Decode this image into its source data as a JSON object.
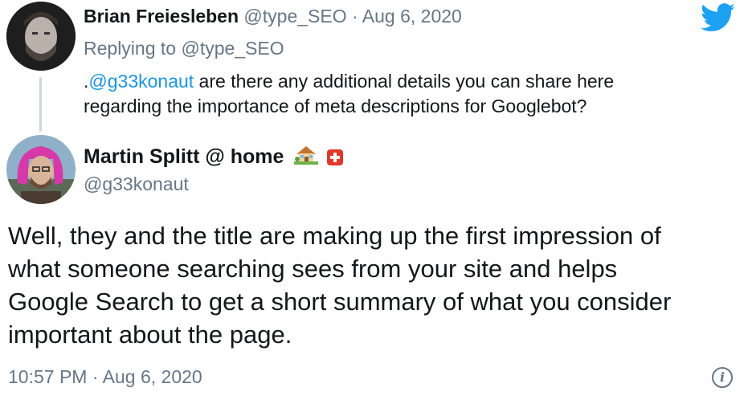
{
  "reply_tweet": {
    "author_name": "Brian Freiesleben",
    "author_handle": "@type_SEO",
    "separator": "·",
    "date": "Aug 6, 2020",
    "replying_to_prefix": "Replying to",
    "replying_to_handle": "@type_SEO",
    "text_prefix": ".",
    "mention": "@g33konaut",
    "text_line1_rest": " are there any additional details you can share here",
    "text_line2": "regarding the importance of meta descriptions for Googlebot?"
  },
  "main_tweet": {
    "author_name": "Martin Splitt @ home",
    "author_handle": "@g33konaut",
    "text_lines": [
      "Well, they and the title are making up the first impression of",
      "what someone searching sees from your site and helps",
      "Google Search to get a short summary of what you consider",
      "important about the page."
    ],
    "time": "10:57 PM",
    "separator": "·",
    "date": "Aug 6, 2020"
  },
  "icons": {
    "logo": "twitter-bird-icon",
    "info": "info-icon",
    "house_emoji": "house-with-garden-icon",
    "flag": "swiss-flag-icon"
  },
  "colors": {
    "twitter_blue": "#1da1f2",
    "link": "#1b95e0",
    "muted": "#657786",
    "text": "#14171a"
  }
}
